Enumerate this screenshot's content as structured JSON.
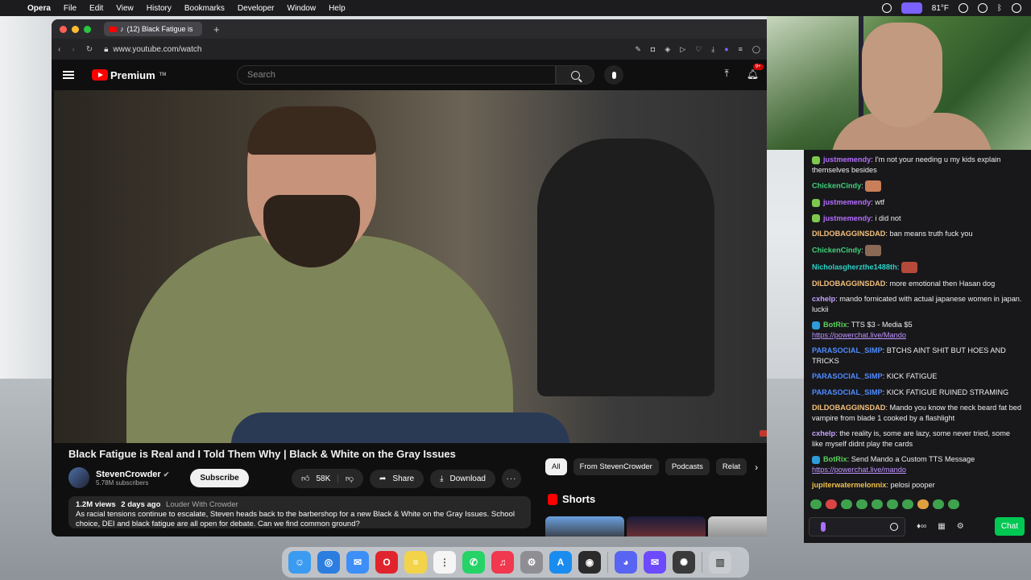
{
  "menubar": {
    "app": "Opera",
    "items": [
      "File",
      "Edit",
      "View",
      "History",
      "Bookmarks",
      "Developer",
      "Window",
      "Help"
    ],
    "weather": "81°F"
  },
  "browser": {
    "tab_title": "(12) Black Fatigue is",
    "url": "www.youtube.com/watch"
  },
  "youtube": {
    "logo": "Premium",
    "logo_tm": "TM",
    "search_placeholder": "Search",
    "notification_badge": "9+",
    "video_title": "Black Fatigue is Real and I Told Them Why | Black & White on the Gray Issues",
    "channel_name": "StevenCrowder",
    "channel_subs": "5.78M subscribers",
    "subscribe": "Subscribe",
    "likes": "58K",
    "share": "Share",
    "download": "Download",
    "views": "1.2M views",
    "age": "2 days ago",
    "show": "Louder With Crowder",
    "description": "As racial tensions continue to escalate, Steven heads back to the barbershop for a new Black & White on the Gray Issues. School choice, DEI and black fatigue are all open for debate. Can we find common ground?",
    "chips": [
      "All",
      "From StevenCrowder",
      "Podcasts",
      "Relat"
    ],
    "shorts": "Shorts"
  },
  "chat": {
    "messages": [
      {
        "user": "justmemendy",
        "color": "#b46eff",
        "badge": "#7ec850",
        "text": "I'm not your needing u my kids explain themselves besides"
      },
      {
        "user": "ChickenCindy",
        "color": "#3fd47a",
        "text": "",
        "emote": "#c97f5a"
      },
      {
        "user": "justmemendy",
        "color": "#b46eff",
        "badge": "#7ec850",
        "text": "wtf"
      },
      {
        "user": "justmemendy",
        "color": "#b46eff",
        "badge": "#7ec850",
        "text": "i did not"
      },
      {
        "user": "DILDOBAGGINSDAD",
        "color": "#f5c07a",
        "text": "ban means truth fuck you"
      },
      {
        "user": "ChickenCindy",
        "color": "#3fd47a",
        "text": "",
        "emote": "#8a6a55"
      },
      {
        "user": "Nicholasgherzthe1488th",
        "color": "#2bd4c8",
        "text": "",
        "emote": "#b5493a"
      },
      {
        "user": "DILDOBAGGINSDAD",
        "color": "#f5c07a",
        "text": "more emotional then Hasan dog"
      },
      {
        "user": "cxhelp",
        "color": "#c4a3ff",
        "text": "mando fornicated with actual japanese women in japan. luckii"
      },
      {
        "user": "BotRix",
        "color": "#5ad15a",
        "badge": "#2f9bd8",
        "text": "TTS $3 - Media $5",
        "link": "https://powerchat.live/Mando"
      },
      {
        "user": "PARASOCIAL_SIMP",
        "color": "#4f8cff",
        "text": "BTCHS AINT SHIT BUT HOES AND TRICKS"
      },
      {
        "user": "PARASOCIAL_SIMP",
        "color": "#4f8cff",
        "text": "KICK FATIGUE"
      },
      {
        "user": "PARASOCIAL_SIMP",
        "color": "#4f8cff",
        "text": "KICK FATIGUE RUINED STRAMING"
      },
      {
        "user": "DILDOBAGGINSDAD",
        "color": "#f5c07a",
        "text": "Mando you know the neck beard fat bed vampire from blade 1 cooked by a flashlight"
      },
      {
        "user": "cxhelp",
        "color": "#c4a3ff",
        "text": "the reality is, some are lazy, some never tried, some like myself didnt play the cards"
      },
      {
        "user": "BotRix",
        "color": "#5ad15a",
        "badge": "#2f9bd8",
        "text": "Send Mando a Custom TTS Message",
        "link": "https://powerchat.live/mando"
      },
      {
        "user": "jupiterwatermelonnix",
        "color": "#f0c04a",
        "text": "pelosi pooper"
      }
    ],
    "chat_button": "Chat"
  },
  "dock": {
    "apps": [
      {
        "name": "finder-icon",
        "color": "#3a9bf0",
        "glyph": "☺"
      },
      {
        "name": "safari-icon",
        "color": "#2c7de0",
        "glyph": "◎"
      },
      {
        "name": "mail-icon",
        "color": "#3d8ef7",
        "glyph": "✉"
      },
      {
        "name": "opera-icon",
        "color": "#e0242e",
        "glyph": "O"
      },
      {
        "name": "notes-icon",
        "color": "#f3d34a",
        "glyph": "≡"
      },
      {
        "name": "reminders-icon",
        "color": "#f5f5f5",
        "glyph": "⋮"
      },
      {
        "name": "whatsapp-icon",
        "color": "#25d366",
        "glyph": "✆"
      },
      {
        "name": "music-icon",
        "color": "#f0384f",
        "glyph": "♫"
      },
      {
        "name": "settings-icon",
        "color": "#8e8e93",
        "glyph": "⚙"
      },
      {
        "name": "appstore-icon",
        "color": "#1a8cf0",
        "glyph": "A"
      },
      {
        "name": "obs-icon",
        "color": "#2b2b2b",
        "glyph": "◉"
      },
      {
        "name": "discord-icon",
        "color": "#5865f2",
        "glyph": "◕"
      },
      {
        "name": "proton-mail-icon",
        "color": "#6d4aff",
        "glyph": "✉"
      },
      {
        "name": "chatgpt-icon",
        "color": "#3a3a3a",
        "glyph": "✺"
      },
      {
        "name": "trash-icon",
        "color": "#c9ccd0",
        "glyph": "▥"
      }
    ]
  }
}
